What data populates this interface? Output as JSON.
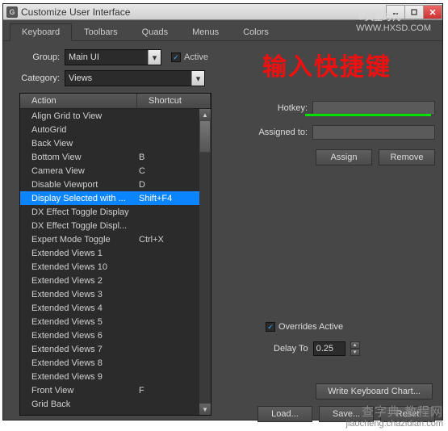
{
  "window": {
    "title": "Customize User Interface"
  },
  "tabs": [
    "Keyboard",
    "Toolbars",
    "Quads",
    "Menus",
    "Colors"
  ],
  "group": {
    "label": "Group:",
    "value": "Main UI"
  },
  "active": {
    "label": "Active",
    "checked": true
  },
  "category": {
    "label": "Category:",
    "value": "Views"
  },
  "table": {
    "headers": [
      "Action",
      "Shortcut"
    ],
    "rows": [
      {
        "a": "Align Grid to View",
        "s": ""
      },
      {
        "a": "AutoGrid",
        "s": ""
      },
      {
        "a": "Back View",
        "s": ""
      },
      {
        "a": "Bottom View",
        "s": "B"
      },
      {
        "a": "Camera View",
        "s": "C"
      },
      {
        "a": "Disable Viewport",
        "s": "D"
      },
      {
        "a": "Display Selected with ...",
        "s": "Shift+F4",
        "sel": true
      },
      {
        "a": "DX Effect Toggle Display",
        "s": ""
      },
      {
        "a": "DX Effect Toggle Displ...",
        "s": ""
      },
      {
        "a": "Expert Mode Toggle",
        "s": "Ctrl+X"
      },
      {
        "a": "Extended Views 1",
        "s": ""
      },
      {
        "a": "Extended Views 10",
        "s": ""
      },
      {
        "a": "Extended Views 2",
        "s": ""
      },
      {
        "a": "Extended Views 3",
        "s": ""
      },
      {
        "a": "Extended Views 4",
        "s": ""
      },
      {
        "a": "Extended Views 5",
        "s": ""
      },
      {
        "a": "Extended Views 6",
        "s": ""
      },
      {
        "a": "Extended Views 7",
        "s": ""
      },
      {
        "a": "Extended Views 8",
        "s": ""
      },
      {
        "a": "Extended Views 9",
        "s": ""
      },
      {
        "a": "Front View",
        "s": "F"
      },
      {
        "a": "Grid Back",
        "s": ""
      }
    ]
  },
  "hotkey": {
    "label": "Hotkey:"
  },
  "assigned": {
    "label": "Assigned to:"
  },
  "buttons": {
    "assign": "Assign",
    "remove": "Remove",
    "wkc": "Write Keyboard Chart...",
    "load": "Load...",
    "save": "Save...",
    "reset": "Reset"
  },
  "overrides": {
    "label": "Overrides Active",
    "checked": true,
    "delay_label": "Delay To",
    "delay_value": "0.25"
  },
  "annotation": "输入快捷键",
  "topwatermark": {
    "logo": "☉火星时代",
    "url": "WWW.HXSD.COM"
  },
  "watermark": {
    "line1": "查字典 教程网",
    "line2": "jiaocheng.chazidian.com"
  }
}
